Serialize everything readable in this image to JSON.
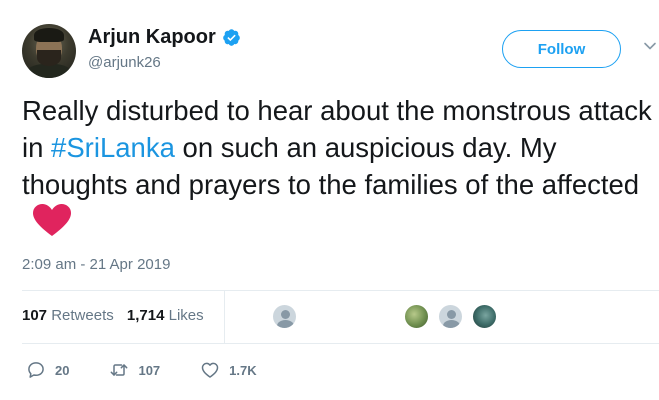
{
  "author": {
    "display_name": "Arjun Kapoor",
    "handle": "@arjunk26",
    "verified": true
  },
  "follow_button_label": "Follow",
  "tweet": {
    "text_before": "Really disturbed to hear about the monstrous attack in ",
    "hashtag": "#SriLanka",
    "text_after": " on such an auspicious day. My thoughts and prayers to the families of the affected",
    "emoji": "red-heart"
  },
  "timestamp": "2:09 am - 21 Apr 2019",
  "stats": {
    "retweets_count": "107",
    "retweets_label": "Retweets",
    "likes_count": "1,714",
    "likes_label": "Likes"
  },
  "actions": {
    "reply_count": "20",
    "retweet_count": "107",
    "like_count": "1.7K"
  },
  "colors": {
    "accent": "#1da1f2",
    "hashtag": "#1b95e0",
    "muted": "#657786",
    "heart": "#e0245e"
  },
  "icons": [
    "verified-badge-icon",
    "caret-down-icon",
    "reply-icon",
    "retweet-icon",
    "like-icon"
  ]
}
